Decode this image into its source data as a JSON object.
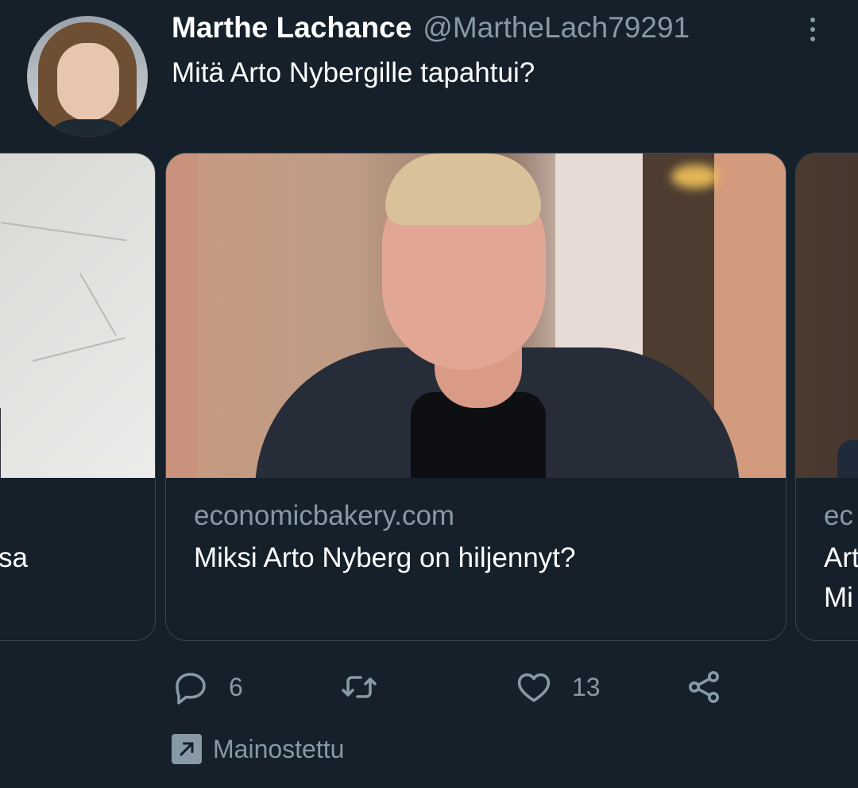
{
  "author": {
    "display_name": "Marthe Lachance",
    "handle": "@MartheLach79291"
  },
  "tweet": {
    "text": "Mitä Arto Nybergille tapahtui?"
  },
  "carousel": {
    "cards": [
      {
        "domain": "",
        "title": "sa"
      },
      {
        "domain": "economicbakery.com",
        "title": "Miksi Arto Nyberg on hiljennyt?"
      },
      {
        "domain": "ec",
        "title": "Art",
        "title_line2": "Mi"
      }
    ]
  },
  "actions": {
    "reply_count": "6",
    "retweet_count": "",
    "like_count": "13"
  },
  "promoted": {
    "label": "Mainostettu"
  },
  "icons": {
    "more": "more-vertical-icon",
    "reply": "reply-icon",
    "retweet": "retweet-icon",
    "like": "heart-icon",
    "share": "share-icon",
    "promoted": "promoted-arrow-icon"
  },
  "colors": {
    "background": "#15202b",
    "secondary_text": "#8899a6",
    "border": "#38444d"
  }
}
